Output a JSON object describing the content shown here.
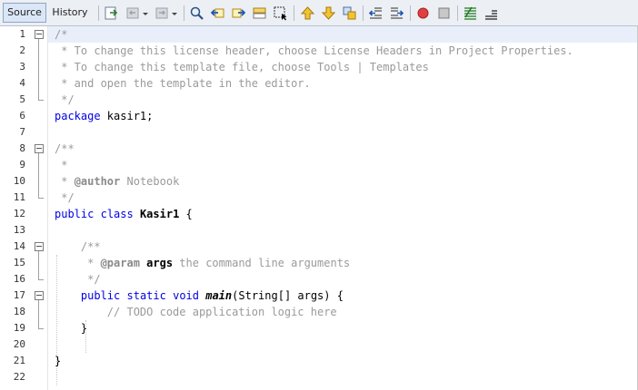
{
  "tabs": [
    {
      "label": "Source",
      "active": true
    },
    {
      "label": "History",
      "active": false
    }
  ],
  "toolbar_icons": [
    "last-edit-icon",
    "back-icon",
    "forward-icon",
    "find-selection-icon",
    "find-previous-icon",
    "find-next-icon",
    "toggle-highlight-icon",
    "toggle-rect-selection-icon",
    "previous-bookmark-icon",
    "next-bookmark-icon",
    "toggle-bookmark-icon",
    "shift-left-icon",
    "shift-right-icon",
    "start-macro-recording-icon",
    "stop-macro-recording-icon",
    "comment-icon",
    "uncomment-icon"
  ],
  "colors": {
    "keyword": "#0000e6",
    "comment": "#9a9a9a",
    "current_line": "#e9effa",
    "record": "#e04040"
  },
  "lines": [
    {
      "n": "1",
      "text": "/*"
    },
    {
      "n": "2",
      "text": " * To change this license header, choose License Headers in Project Properties."
    },
    {
      "n": "3",
      "text": " * To change this template file, choose Tools | Templates"
    },
    {
      "n": "4",
      "text": " * and open the template in the editor."
    },
    {
      "n": "5",
      "text": " */"
    },
    {
      "n": "6",
      "text": "package kasir1;"
    },
    {
      "n": "7",
      "text": ""
    },
    {
      "n": "8",
      "text": "/**"
    },
    {
      "n": "9",
      "text": " *"
    },
    {
      "n": "10",
      "text": " * @author Notebook"
    },
    {
      "n": "11",
      "text": " */"
    },
    {
      "n": "12",
      "text": "public class Kasir1 {"
    },
    {
      "n": "13",
      "text": ""
    },
    {
      "n": "14",
      "text": "    /**"
    },
    {
      "n": "15",
      "text": "     * @param args the command line arguments"
    },
    {
      "n": "16",
      "text": "     */"
    },
    {
      "n": "17",
      "text": "    public static void main(String[] args) {"
    },
    {
      "n": "18",
      "text": "        // TODO code application logic here"
    },
    {
      "n": "19",
      "text": "    }"
    },
    {
      "n": "20",
      "text": ""
    },
    {
      "n": "21",
      "text": "}"
    },
    {
      "n": "22",
      "text": ""
    }
  ]
}
